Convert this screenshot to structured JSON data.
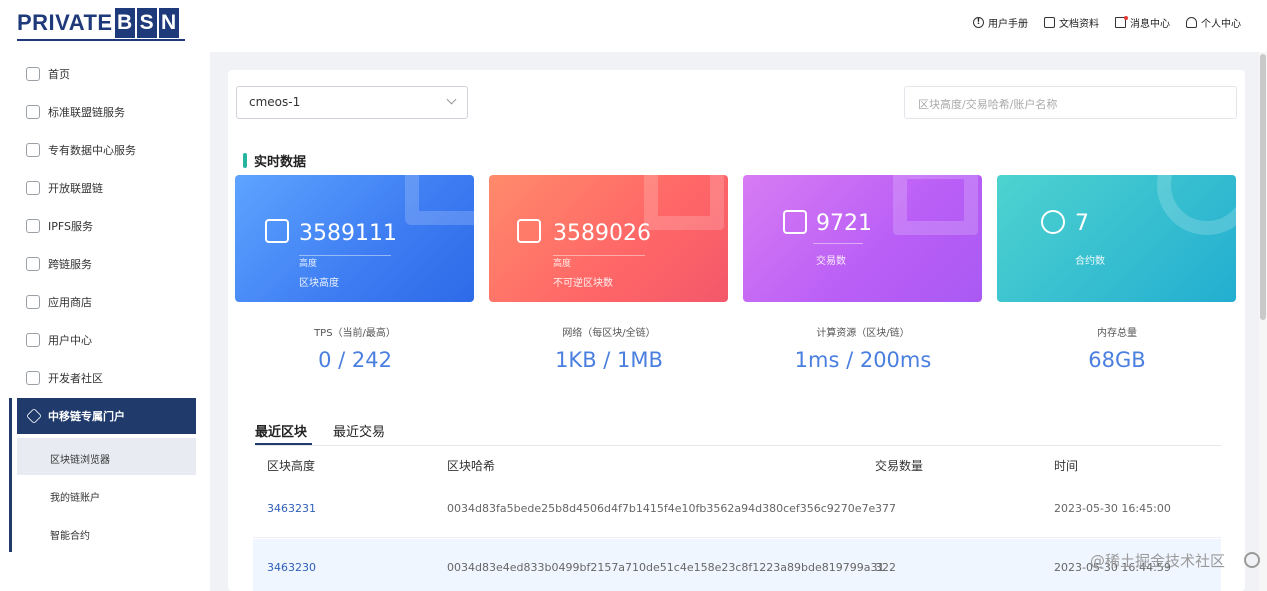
{
  "logo": {
    "word": "PRIVATE",
    "boxes": [
      "B",
      "S",
      "N"
    ]
  },
  "topnav": [
    {
      "label": "用户手册",
      "icon": "help-icon"
    },
    {
      "label": "文档资料",
      "icon": "document-icon"
    },
    {
      "label": "消息中心",
      "icon": "mail-icon"
    },
    {
      "label": "个人中心",
      "icon": "user-icon"
    }
  ],
  "sidebar": {
    "items": [
      {
        "label": "首页",
        "icon": "home-icon"
      },
      {
        "label": "标准联盟链服务",
        "icon": "grid-icon"
      },
      {
        "label": "专有数据中心服务",
        "icon": "network-icon"
      },
      {
        "label": "开放联盟链",
        "icon": "home-icon"
      },
      {
        "label": "IPFS服务",
        "icon": "ipfs-icon"
      },
      {
        "label": "跨链服务",
        "icon": "cross-chain-icon"
      },
      {
        "label": "应用商店",
        "icon": "store-icon"
      },
      {
        "label": "用户中心",
        "icon": "user-icon"
      },
      {
        "label": "开发者社区",
        "icon": "layers-icon"
      }
    ],
    "active": {
      "label": "中移链专属门户",
      "icon": "layers-icon"
    },
    "sub": [
      "区块链浏览器",
      "我的链账户",
      "智能合约"
    ]
  },
  "main": {
    "chain_select": "cmeos-1",
    "search_placeholder": "区块高度/交易哈希/账户名称",
    "section_title": "实时数据",
    "cards": [
      {
        "value": "3589111",
        "label": "高度",
        "label2": "区块高度",
        "color": "#3d7cf2"
      },
      {
        "value": "3589026",
        "label": "高度",
        "label2": "不可逆区块数",
        "color": "#ff6667"
      },
      {
        "value": "9721",
        "label": "交易数",
        "color": "#b95ef6"
      },
      {
        "value": "7",
        "label": "合约数",
        "color": "#34bcd0"
      }
    ],
    "metrics": [
      {
        "label": "TPS（当前/最高）",
        "value": "0 / 242"
      },
      {
        "label": "网络（每区块/全链）",
        "value": "1KB / 1MB"
      },
      {
        "label": "计算资源（区块/链）",
        "value": "1ms / 200ms"
      },
      {
        "label": "内存总量",
        "value": "68GB"
      }
    ],
    "tabs": [
      "最近区块",
      "最近交易"
    ],
    "table": {
      "headers": [
        "区块高度",
        "区块哈希",
        "交易数量",
        "时间"
      ],
      "rows": [
        [
          "3463231",
          "0034d83fa5bede25b8d4506d4f7b1415f4e10fb3562a94d380cef356c9270e7e",
          "377",
          "2023-05-30 16:45:00"
        ],
        [
          "3463230",
          "0034d83e4ed833b0499bf2157a710de51c4e158e23c8f1223a89bde819799a31",
          "322",
          "2023-05-30 16:44:59"
        ]
      ]
    }
  },
  "watermark": "@稀土掘金技术社区"
}
